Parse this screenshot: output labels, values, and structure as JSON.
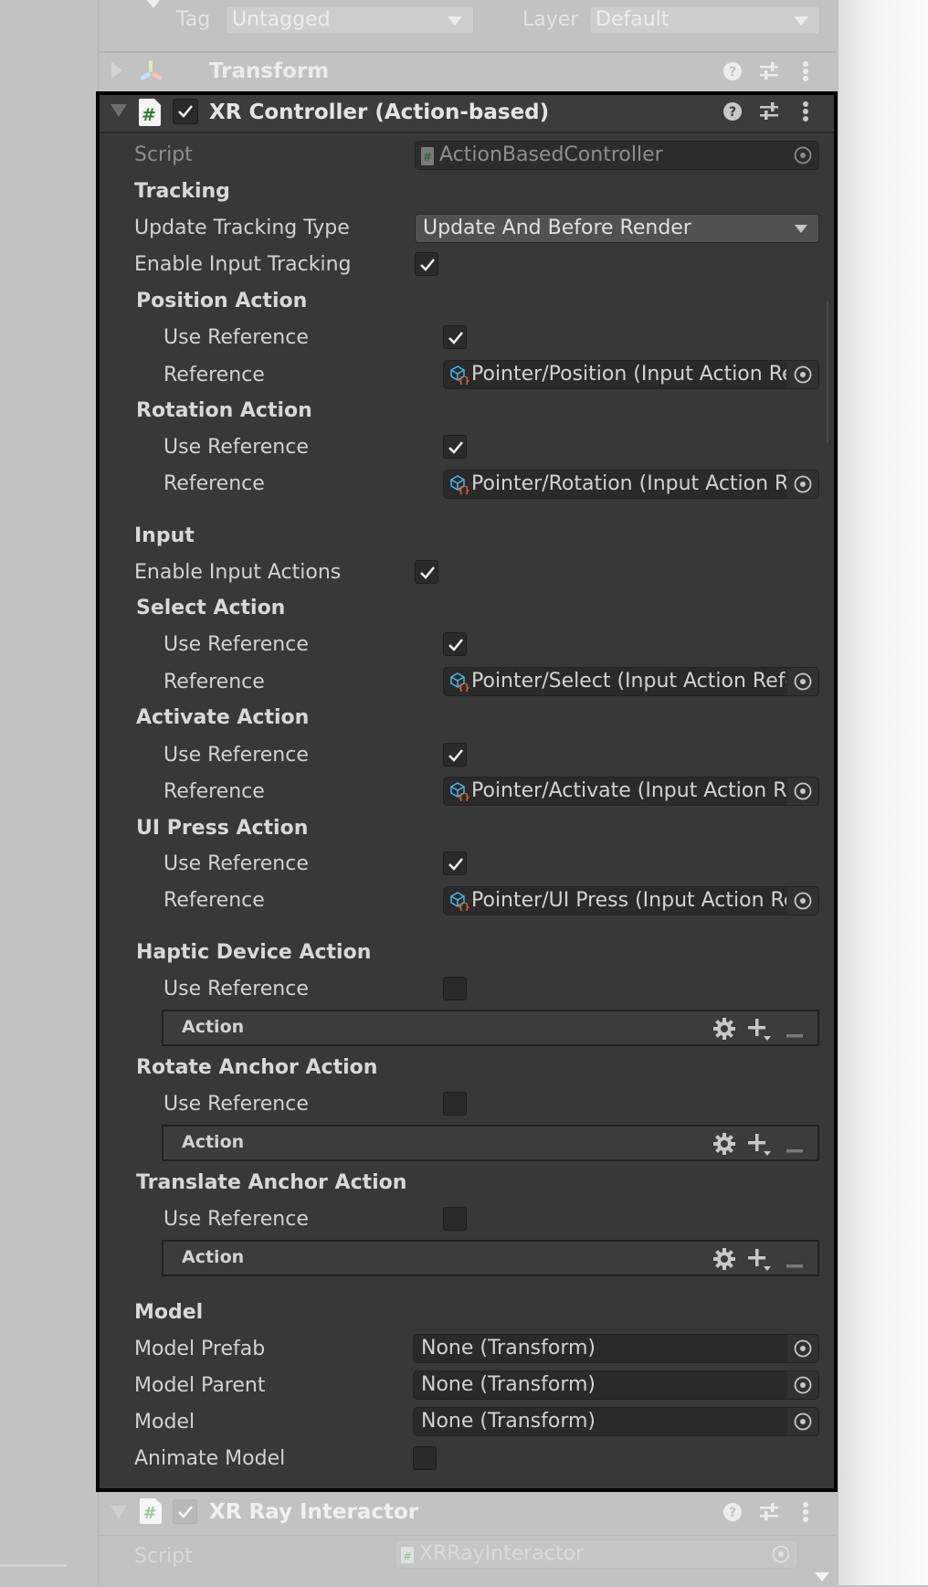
{
  "gameobject": {
    "tag_label": "Tag",
    "tag_value": "Untagged",
    "layer_label": "Layer",
    "layer_value": "Default"
  },
  "transform": {
    "title": "Transform"
  },
  "component": {
    "title": "XR Controller (Action-based)",
    "enabled": true,
    "script_label": "Script",
    "script_value": "ActionBasedController",
    "tracking_header": "Tracking",
    "update_tracking_type_label": "Update Tracking Type",
    "update_tracking_type_value": "Update And Before Render",
    "enable_input_tracking_label": "Enable Input Tracking",
    "enable_input_tracking": true,
    "input_header": "Input",
    "enable_input_actions_label": "Enable Input Actions",
    "enable_input_actions": true,
    "use_reference_label": "Use Reference",
    "reference_label": "Reference",
    "action_label": "Action",
    "reference_actions": [
      {
        "name": "Position Action",
        "use_reference": true,
        "reference": "Pointer/Position (Input Action Reference)"
      },
      {
        "name": "Rotation Action",
        "use_reference": true,
        "reference": "Pointer/Rotation (Input Action Reference)"
      },
      {
        "name": "Select Action",
        "use_reference": true,
        "reference": "Pointer/Select (Input Action Reference)"
      },
      {
        "name": "Activate Action",
        "use_reference": true,
        "reference": "Pointer/Activate (Input Action Reference)"
      },
      {
        "name": "UI Press Action",
        "use_reference": true,
        "reference": "Pointer/UI Press (Input Action Reference)"
      }
    ],
    "inline_actions": [
      {
        "name": "Haptic Device Action",
        "use_reference": false
      },
      {
        "name": "Rotate Anchor Action",
        "use_reference": false
      },
      {
        "name": "Translate Anchor Action",
        "use_reference": false
      }
    ],
    "model_header": "Model",
    "model_fields": [
      {
        "label": "Model Prefab",
        "value": "None (Transform)"
      },
      {
        "label": "Model Parent",
        "value": "None (Transform)"
      },
      {
        "label": "Model",
        "value": "None (Transform)"
      }
    ],
    "animate_model_label": "Animate Model",
    "animate_model": false
  },
  "next_component": {
    "title": "XR Ray Interactor",
    "enabled": true,
    "script_label": "Script",
    "script_value": "XRRayInteractor"
  },
  "icons": {
    "help": "help-icon",
    "presets": "presets-icon",
    "menu": "kebab-menu-icon",
    "object_picker": "object-picker-icon",
    "input_action_reference": "input-action-asset-icon",
    "settings": "gear-icon",
    "add": "plus-icon",
    "remove": "minus-icon"
  },
  "colors": {
    "inspector_bg": "#383838",
    "selection_border": "#000000",
    "dimmed_bg": "#c2c2c2",
    "script_icon_green": "#2e7d32",
    "ref_icon_blue": "#4fb3e8",
    "ref_icon_orange": "#f0622d"
  }
}
